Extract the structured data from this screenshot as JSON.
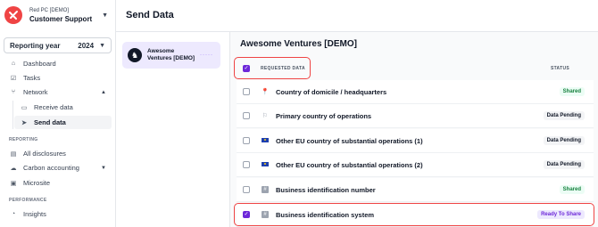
{
  "org": {
    "subtitle": "Red PC [DEMO]",
    "name": "Customer Support"
  },
  "reporting": {
    "label": "Reporting year",
    "value": "2024"
  },
  "nav": {
    "dashboard": "Dashboard",
    "tasks": "Tasks",
    "network": "Network",
    "receive": "Receive data",
    "send": "Send data",
    "reporting_section": "REPORTING",
    "all_disclosures": "All disclosures",
    "carbon": "Carbon accounting",
    "microsite": "Microsite",
    "performance_section": "PERFORMANCE",
    "insights": "Insights"
  },
  "page": {
    "title": "Send Data"
  },
  "company": {
    "name_line1": "Awesome",
    "name_line2": "Ventures [DEMO]",
    "title": "Awesome Ventures [DEMO]"
  },
  "table": {
    "col_requested": "REQUESTED DATA",
    "col_status": "STATUS",
    "rows": [
      {
        "label": "Country of domicile / headquarters",
        "status": "Shared"
      },
      {
        "label": "Primary country of operations",
        "status": "Data Pending"
      },
      {
        "label": "Other EU country of substantial operations (1)",
        "status": "Data Pending"
      },
      {
        "label": "Other EU country of substantial operations (2)",
        "status": "Data Pending"
      },
      {
        "label": "Business identification number",
        "status": "Shared"
      },
      {
        "label": "Business identification system",
        "status": "Ready To Share"
      }
    ]
  },
  "colors": {
    "accent": "#6d28d9",
    "brand_red": "#ef4444",
    "shared": "#15803d"
  }
}
